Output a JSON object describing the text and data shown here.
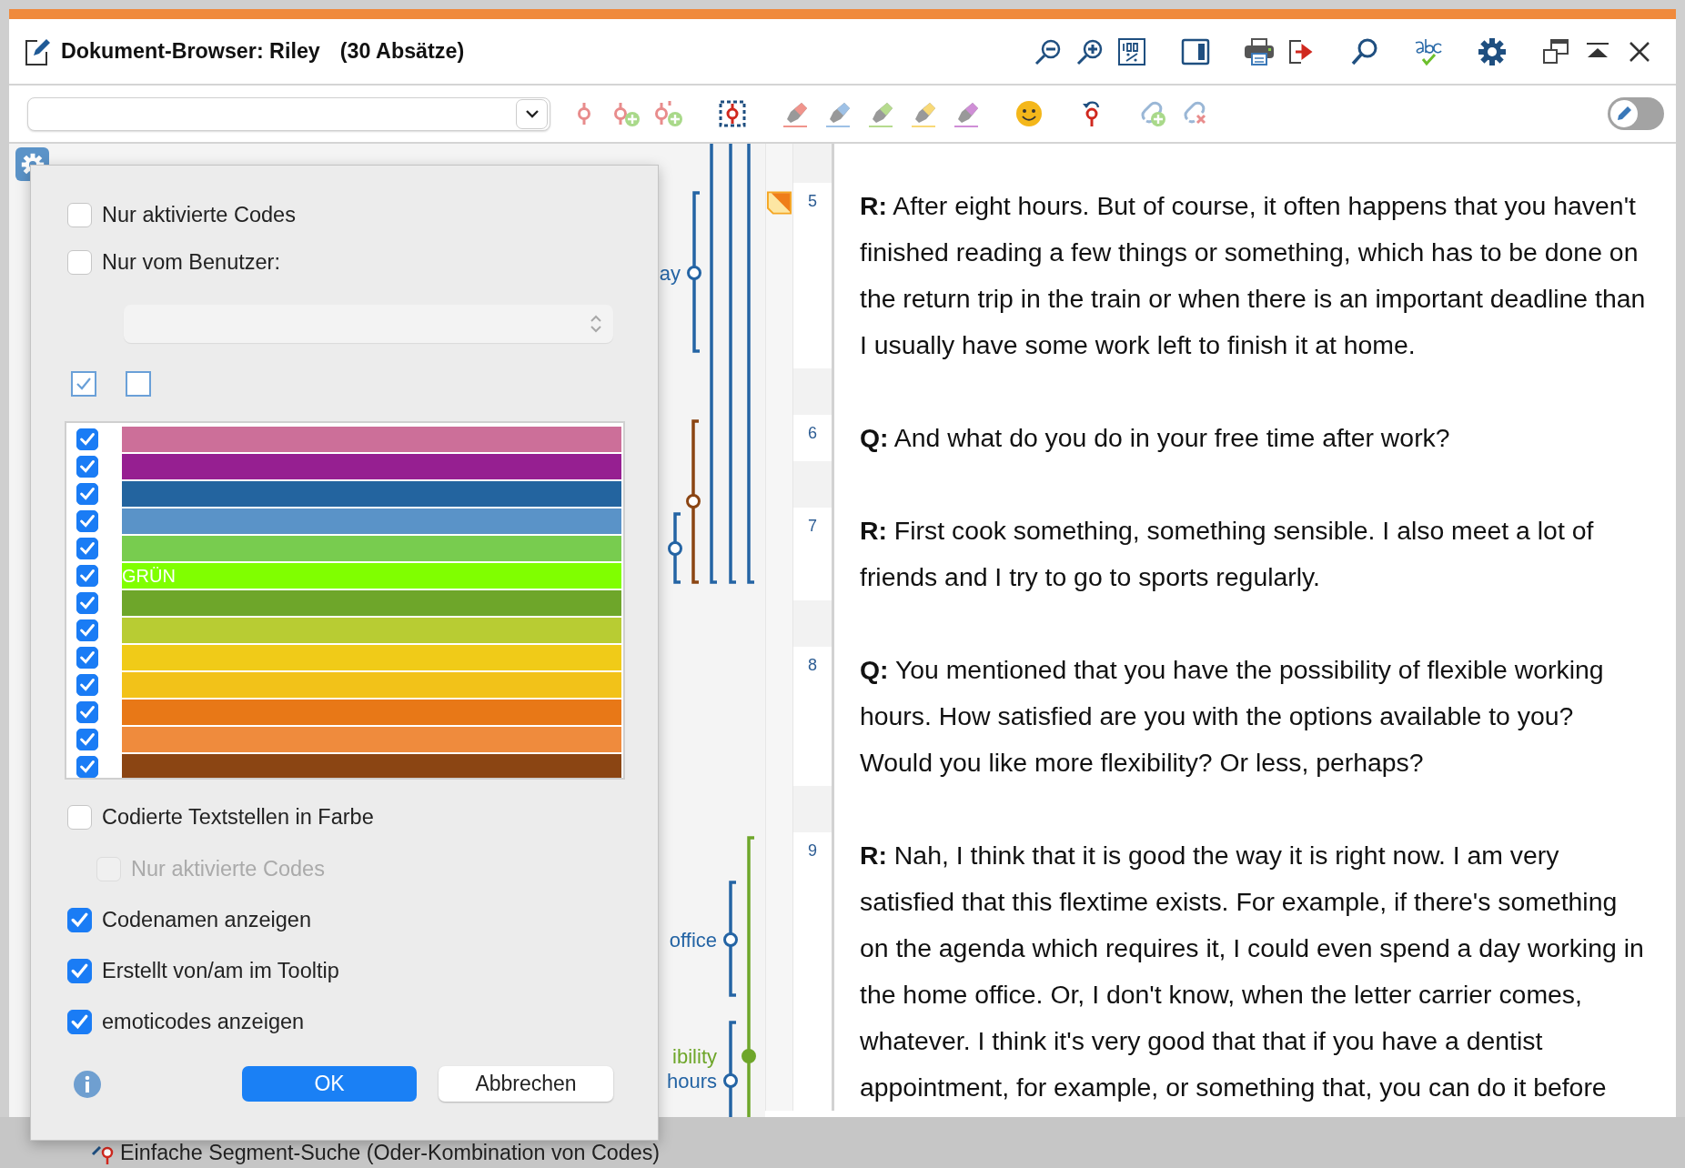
{
  "window": {
    "title": "Dokument-Browser: Riley",
    "subtitle": "(30 Absätze)"
  },
  "toolbar": {
    "code_dropdown": {
      "disabled": false
    },
    "edit_mode": {
      "on": false
    }
  },
  "code_stripes": [
    {
      "color": "#2464a4"
    },
    {
      "color": "#2464a4"
    },
    {
      "color": "#2464a4"
    },
    {
      "color": "#2464a4",
      "filled": false,
      "label": "ay"
    },
    {
      "color": "#8b4513",
      "filled": false
    },
    {
      "color": "#2464a4",
      "filled": false
    },
    {
      "color": "#2464a4",
      "filled": false,
      "label": "office"
    },
    {
      "color": "#6ea62a",
      "filled": true,
      "label": "ibility"
    },
    {
      "color": "#2464a4",
      "filled": false,
      "label": "hours"
    }
  ],
  "paragraphs": [
    {
      "number": "5",
      "memo": true,
      "lines": [
        "**R:** After eight hours. But of course, it often happens that you haven't",
        "finished reading a few things or something, which has to be done on",
        "the return trip in the train or when there is an important deadline than",
        "I usually have some work left to finish it at home."
      ]
    },
    {
      "number": "6",
      "memo": false,
      "lines": [
        "**Q:** And what do you do in your free time after work?"
      ]
    },
    {
      "number": "7",
      "memo": false,
      "lines": [
        "**R:** First cook something, something sensible. I also meet a lot of",
        "friends and I try to go to sports regularly."
      ]
    },
    {
      "number": "8",
      "memo": false,
      "lines": [
        "**Q:** You mentioned that you have the possibility of flexible working",
        "hours. How satisfied are you with the options available to you?",
        "Would you like more flexibility? Or less, perhaps?"
      ]
    },
    {
      "number": "9",
      "memo": false,
      "lines": [
        "**R:** Nah, I think that it is good the way it is right now. I am very",
        "satisfied that this flextime exists. For example, if there's something",
        "on the agenda which requires it, I could even spend a day working in",
        "the home office. Or, I don't know, when the letter carrier comes,",
        "whatever. I think it's very good that that if you have a dentist",
        "appointment, for example, or something that, you can do it before"
      ]
    }
  ],
  "background_window": {
    "text": "Einfache Segment-Suche (Oder-Kombination von Codes)"
  },
  "options_dialog": {
    "filters": [
      {
        "label": "Nur aktivierte Codes",
        "checked": false,
        "disabled": false
      },
      {
        "label": "Nur vom Benutzer:",
        "checked": false,
        "disabled": false
      }
    ],
    "user_select": {
      "disabled": true
    },
    "color_filters": [
      {
        "color": "#cc6f99",
        "checked": true
      },
      {
        "color": "#961f91",
        "checked": true
      },
      {
        "color": "#23649f",
        "checked": true
      },
      {
        "color": "#5a93c8",
        "checked": true
      },
      {
        "color": "#78cc4f",
        "checked": true
      },
      {
        "color": "#80ff00",
        "checked": true,
        "label": "GRÜN"
      },
      {
        "color": "#6ea62a",
        "checked": true
      },
      {
        "color": "#b8cc33",
        "checked": true
      },
      {
        "color": "#f0cb18",
        "checked": true
      },
      {
        "color": "#f2c219",
        "checked": true
      },
      {
        "color": "#e87817",
        "checked": true
      },
      {
        "color": "#ef8b3d",
        "checked": true
      },
      {
        "color": "#8b4513",
        "checked": true
      }
    ],
    "display_options": [
      {
        "label": "Codierte Textstellen in Farbe",
        "checked": false,
        "disabled": false,
        "children": [
          {
            "label": "Nur aktivierte Codes",
            "checked": false,
            "disabled": true
          }
        ]
      },
      {
        "label": "Codenamen anzeigen",
        "checked": true,
        "disabled": false
      },
      {
        "label": "Erstellt von/am im Tooltip",
        "checked": true,
        "disabled": false
      },
      {
        "label": "emoticodes anzeigen",
        "checked": true,
        "disabled": false
      }
    ],
    "buttons": [
      {
        "label": "OK",
        "kind": "primary"
      },
      {
        "label": "Abbrechen",
        "kind": "secondary"
      }
    ]
  }
}
